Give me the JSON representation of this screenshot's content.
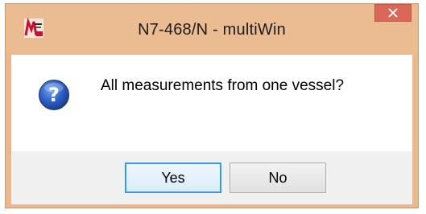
{
  "window": {
    "title": "N7-468/N - multiWin",
    "app_icon": "multiwin-app-icon",
    "close_icon": "close-icon",
    "colors": {
      "frame": "#ebbb92",
      "close": "#d9685b",
      "client": "#f0f0f0",
      "default_button_border": "#3399e8"
    }
  },
  "dialog": {
    "icon": "question-icon",
    "message": "All measurements from one vessel?",
    "buttons": {
      "yes_label": "Yes",
      "no_label": "No"
    },
    "default_button": "yes"
  }
}
